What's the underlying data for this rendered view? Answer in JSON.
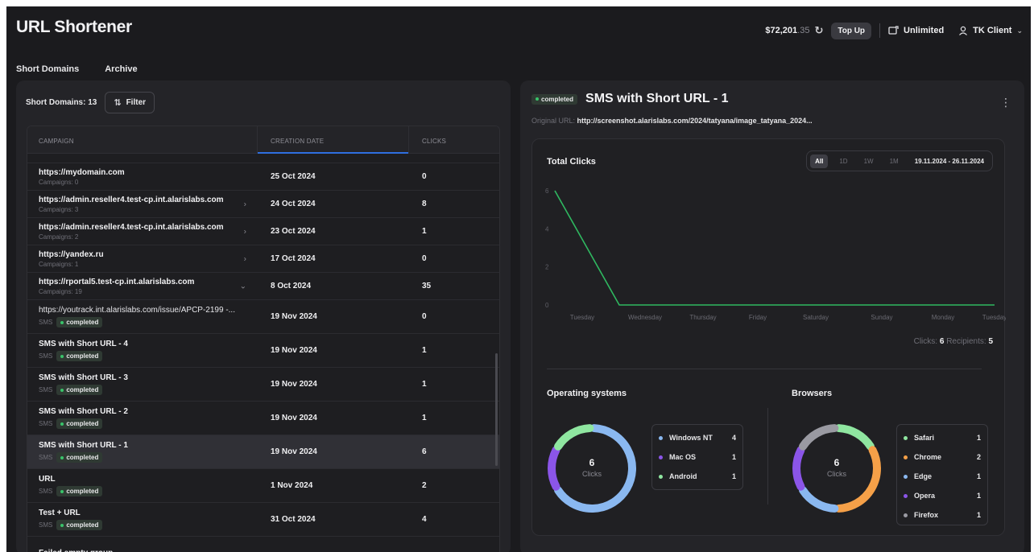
{
  "header": {
    "title": "URL Shortener",
    "balance_main": "$72,201",
    "balance_cents": ".35",
    "refresh_icon": "refresh-icon",
    "topup_label": "Top Up",
    "plan_label": "Unlimited",
    "user_label": "TK Client"
  },
  "tabs": [
    {
      "label": "Short Domains",
      "active": false
    },
    {
      "label": "Archive",
      "active": true
    }
  ],
  "left": {
    "count_label": "Short Domains: 13",
    "filter_label": "Filter",
    "columns": [
      "CAMPAIGN",
      "CREATION DATE",
      "CLICKS"
    ],
    "rows": [
      {
        "name": "https://mydomain.com",
        "sub": "Campaigns: 0",
        "date": "25 Oct 2024",
        "clicks": "0",
        "chevron": ""
      },
      {
        "name": "https://admin.reseller4.test-cp.int.alarislabs.com",
        "sub": "Campaigns: 3",
        "date": "24 Oct 2024",
        "clicks": "8",
        "chevron": "›"
      },
      {
        "name": "https://admin.reseller4.test-cp.int.alarislabs.com",
        "sub": "Campaigns: 2",
        "date": "23 Oct 2024",
        "clicks": "1",
        "chevron": "›"
      },
      {
        "name": "https://yandex.ru",
        "sub": "Campaigns: 1",
        "date": "17 Oct 2024",
        "clicks": "0",
        "chevron": "›"
      },
      {
        "name": "https://rportal5.test-cp.int.alarislabs.com",
        "sub": "Campaigns: 19",
        "date": "8 Oct 2024",
        "clicks": "35",
        "chevron": "⌄"
      },
      {
        "name": "https://youtrack.int.alarislabs.com/issue/APCP-2199 -...",
        "type": "SMS",
        "status": "completed",
        "date": "19 Nov 2024",
        "clicks": "0"
      },
      {
        "name": "SMS with Short URL - 4",
        "type": "SMS",
        "status": "completed",
        "date": "19 Nov 2024",
        "clicks": "1"
      },
      {
        "name": "SMS with Short URL - 3",
        "type": "SMS",
        "status": "completed",
        "date": "19 Nov 2024",
        "clicks": "1"
      },
      {
        "name": "SMS with Short URL - 2",
        "type": "SMS",
        "status": "completed",
        "date": "19 Nov 2024",
        "clicks": "1"
      },
      {
        "name": "SMS with Short URL - 1",
        "type": "SMS",
        "status": "completed",
        "date": "19 Nov 2024",
        "clicks": "6",
        "selected": true
      },
      {
        "name": "URL",
        "type": "SMS",
        "status": "completed",
        "date": "1 Nov 2024",
        "clicks": "2"
      },
      {
        "name": "Test + URL",
        "type": "SMS",
        "status": "completed",
        "date": "31 Oct 2024",
        "clicks": "4"
      },
      {
        "name": "Failed empty group",
        "type": "",
        "status": "",
        "date": "",
        "clicks": ""
      }
    ]
  },
  "detail": {
    "status": "completed",
    "title": "SMS with Short URL - 1",
    "original_url_label": "Original URL:",
    "original_url": "http://screenshot.alarislabs.com/2024/tatyana/image_tatyana_2024...",
    "total_clicks_title": "Total Clicks",
    "periods": [
      "All",
      "1D",
      "1W",
      "1M"
    ],
    "active_period": "All",
    "date_range": "19.11.2024 - 26.11.2024",
    "clicks_label": "Clicks:",
    "clicks_value": "6",
    "recipients_label": "Recipients:",
    "recipients_value": "5",
    "os_title": "Operating systems",
    "browsers_title": "Browsers",
    "donut_label": "Clicks",
    "os_total": "6",
    "browsers_total": "6"
  },
  "chart_data": [
    {
      "type": "line",
      "title": "Total Clicks",
      "x": [
        "Tuesday",
        "Wednesday",
        "Thursday",
        "Friday",
        "Saturday",
        "Sunday",
        "Monday",
        "Tuesday"
      ],
      "series": [
        {
          "values": [
            6,
            0,
            0,
            0,
            0,
            0,
            0,
            0
          ],
          "color": "#2fb860"
        }
      ],
      "yticks": [
        0,
        2,
        4,
        6
      ],
      "ylim": [
        0,
        6
      ],
      "grid": false
    },
    {
      "type": "pie",
      "title": "Operating systems",
      "categories": [
        "Windows NT",
        "Mac OS",
        "Android"
      ],
      "values": [
        4,
        1,
        1
      ],
      "colors": [
        "#8ab8f0",
        "#8b55e8",
        "#8fe6a0"
      ]
    },
    {
      "type": "pie",
      "title": "Browsers",
      "categories": [
        "Safari",
        "Chrome",
        "Edge",
        "Opera",
        "Firefox"
      ],
      "values": [
        1,
        2,
        1,
        1,
        1
      ],
      "colors": [
        "#8fe6a0",
        "#f5a048",
        "#8ab8f0",
        "#8b55e8",
        "#9a9aa2"
      ]
    }
  ]
}
